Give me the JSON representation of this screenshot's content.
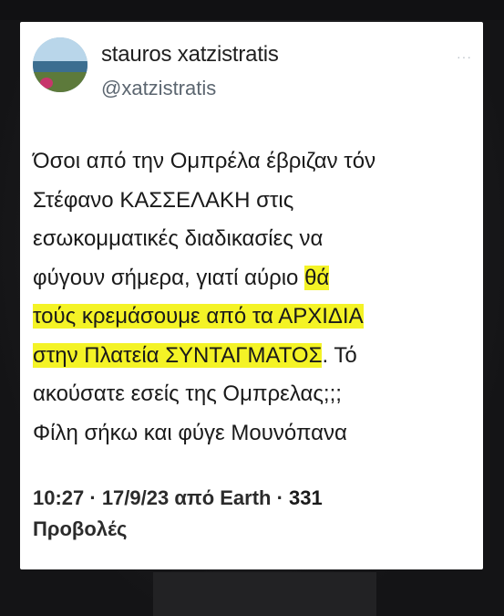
{
  "tweet": {
    "display_name": "stauros xatzistratis",
    "handle": "@xatzistratis",
    "more_menu": "···",
    "lines": [
      {
        "pre": "Όσοι από την Ομπρέλα έβριζαν τόν",
        "hl": ""
      },
      {
        "pre": "Στέφανο ΚΑΣΣΕΛΑΚΗ στις",
        "hl": ""
      },
      {
        "pre": "εσωκομματικές διαδικασίες να",
        "hl": ""
      },
      {
        "pre": "φύγουν σήμερα, γιατί αύριο ",
        "hl": "θά"
      },
      {
        "pre": "",
        "hl": "τούς κρεμάσουμε από τα ΑΡΧΙΔΙΑ"
      },
      {
        "pre": "",
        "hl": "στην Πλατεία ΣΥΝΤΑΓΜΑΤΟΣ",
        "post": ". Τό"
      },
      {
        "pre": "ακούσατε εσείς της Ομπρελας;;;",
        "hl": ""
      },
      {
        "pre": "Φίλη σήκω και φύγε Μουνόπανα",
        "hl": ""
      }
    ],
    "timestamp": "10:27 · 17/9/23 από Earth · ",
    "views_count": "331",
    "views_label": "Προβολές"
  },
  "colors": {
    "card_bg": "#ffffff",
    "highlight": "#f4f326",
    "page_bg": "#1c1c1e"
  },
  "icons": [
    "avatar-image",
    "more-options-icon"
  ]
}
